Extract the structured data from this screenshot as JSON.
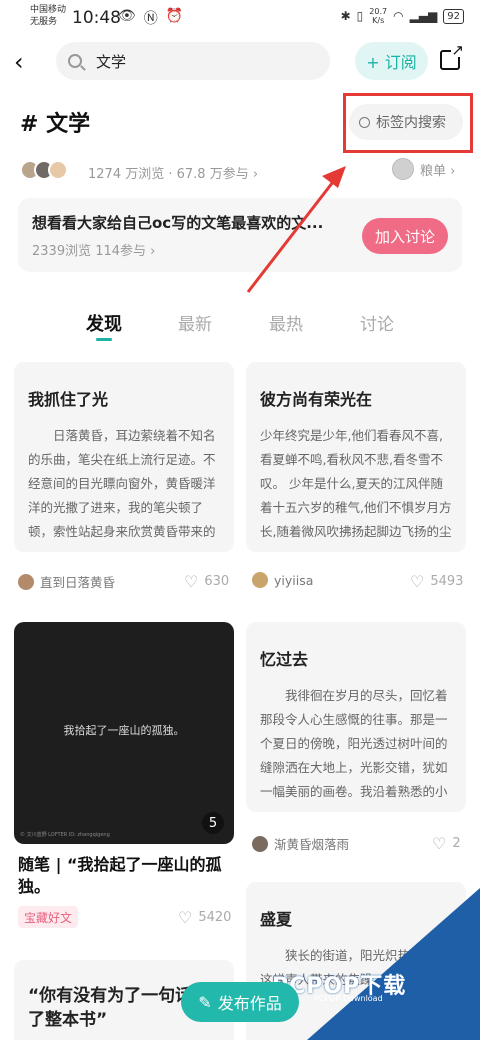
{
  "status": {
    "carrier_line1": "中国移动",
    "carrier_line2": "无服务",
    "time": "10:48",
    "net_speed": "20.7",
    "net_unit": "K/s",
    "battery": "92"
  },
  "header": {
    "search_text": "文学",
    "subscribe_label": "+ 订阅"
  },
  "topic": {
    "title": "# 文学",
    "tag_search_placeholder": "标签内搜索",
    "stats": "1274 万浏览 · 67.8 万参与 ›",
    "rank_label": "粮单 ›"
  },
  "discussion": {
    "question": "想看看大家给自己oc写的文笔最喜欢的文...",
    "meta": "2339浏览  114参与 ›",
    "join_label": "加入讨论"
  },
  "tabs": [
    {
      "label": "发现"
    },
    {
      "label": "最新"
    },
    {
      "label": "最热"
    },
    {
      "label": "讨论"
    }
  ],
  "cards": [
    {
      "title": "我抓住了光",
      "body": "日落黄昏，耳边萦绕着不知名的乐曲，笔尖在纸上流行足迹。不经意间的目光瞟向窗外，黄昏暖洋洋的光撒了进来，我的笔尖顿了顿，索性站起身来欣赏黄昏带来的佳礼。        云朵好...",
      "author": "直到日落黄昏",
      "likes": "630"
    },
    {
      "title": "彼方尚有荣光在",
      "body": "少年终究是少年,他们看春风不喜,看夏蝉不鸣,看秋风不悲,看冬雪不叹。 少年是什么,夏天的江风伴随着十五六岁的稚气,他们不惧岁月方长,随着微风吹拂扬起脚边飞扬的尘土,从不回头,猛地向",
      "author": "yiyiisa",
      "likes": "5493"
    },
    {
      "image_text": "我拾起了一座山的孤独。",
      "watermark": "© 文川蓝野  LOFTER ID: zhangqigeng",
      "image_count": "5",
      "title": "随笔 | “我拾起了一座山的孤独。",
      "badge": "宝藏好文",
      "likes": "5420"
    },
    {
      "title": "忆过去",
      "body": "我徘徊在岁月的尽头，回忆着那段令人心生感慨的往事。那是一个夏日的傍晚，阳光透过树叶间的缝隙洒在大地上，光影交错，犹如一幅美丽的画卷。我沿着熟悉的小径漫步，一路上，...",
      "author": "渐黄昏烟落雨",
      "likes": "2"
    },
    {
      "title": "“你有没有为了一句话看了整本书”"
    },
    {
      "title": "盛夏",
      "body": "狭长的街道，阳光炽热，抱怨这蝉声人带来的焦躁。      我漫"
    }
  ],
  "fab_label": "发布作品",
  "brand_watermark": "PCPOP下载",
  "brand_small": "PCPOP Download",
  "colors": {
    "accent": "#1ab3a6",
    "join_button": "#f06b85",
    "highlight_box": "#e53935"
  }
}
